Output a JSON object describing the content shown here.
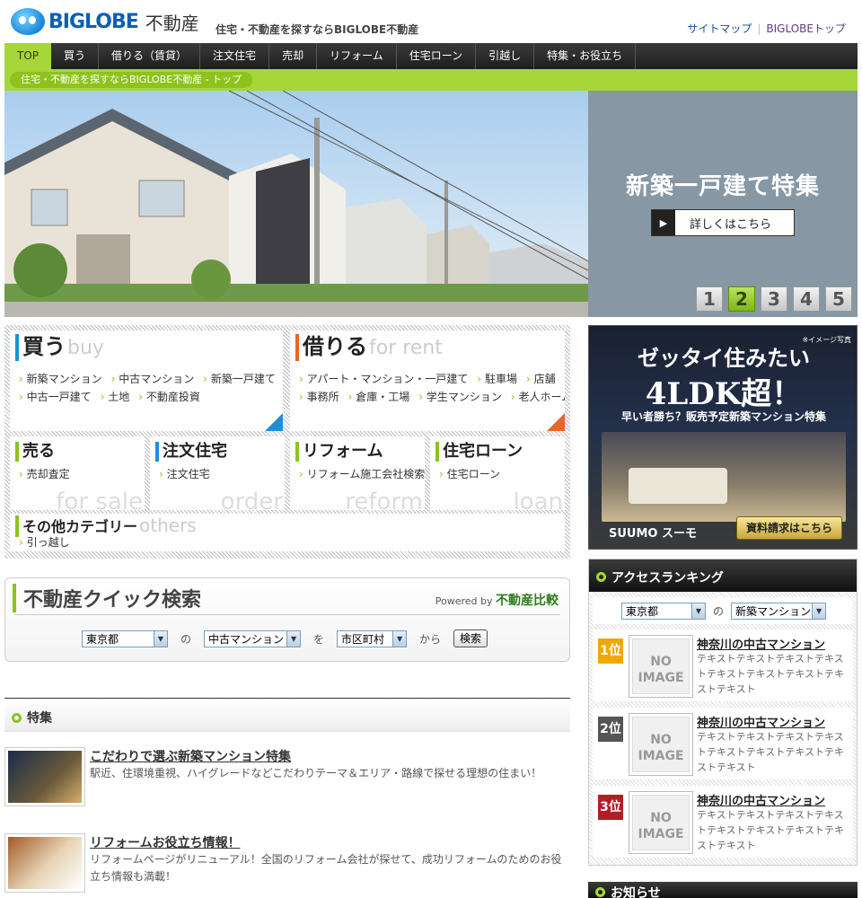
{
  "brand": {
    "logo_text": "BIGLOBE",
    "logo_suffix": "不動産",
    "tagline": "住宅・不動産を探すならBIGLOBE不動産"
  },
  "top_links": {
    "sitemap": "サイトマップ",
    "biglobe_top": "BIGLOBEトップ"
  },
  "nav": [
    "TOP",
    "買う",
    "借りる（賃貸）",
    "注文住宅",
    "売却",
    "リフォーム",
    "住宅ローン",
    "引越し",
    "特集・お役立ち"
  ],
  "breadcrumb": "住宅・不動産を探すならBIGLOBE不動産 - トップ",
  "hero": {
    "title": "新築一戸建て特集",
    "button": "詳しくはこちら",
    "pages": [
      "1",
      "2",
      "3",
      "4",
      "5"
    ],
    "active_page": "2"
  },
  "categories": {
    "buy": {
      "title": "買う",
      "en": "buy",
      "links": [
        "新築マンション",
        "中古マンション",
        "新築一戸建て",
        "中古一戸建て",
        "土地",
        "不動産投資"
      ]
    },
    "rent": {
      "title": "借りる",
      "en": "for rent",
      "links": [
        "アパート・マンション・一戸建て",
        "駐車場",
        "店舗",
        "事務所",
        "倉庫・工場",
        "学生マンション",
        "老人ホーム"
      ]
    },
    "sell": {
      "title": "売る",
      "en": "for sale",
      "links": [
        "売却査定"
      ]
    },
    "order": {
      "title": "注文住宅",
      "en": "order",
      "links": [
        "注文住宅"
      ]
    },
    "reform": {
      "title": "リフォーム",
      "en": "reform",
      "links": [
        "リフォーム施工会社検索"
      ]
    },
    "loan": {
      "title": "住宅ローン",
      "en": "loan",
      "links": [
        "住宅ローン"
      ]
    },
    "others": {
      "title": "その他カテゴリー",
      "en": "others",
      "links": [
        "引っ越し"
      ]
    }
  },
  "quick_search": {
    "title": "不動産クイック検索",
    "powered_by": "Powered by",
    "powered_brand": "不動産比較",
    "pref": "東京都",
    "of": "の",
    "type": "中古マンション",
    "wo": "を",
    "area": "市区町村",
    "kara": "から",
    "button": "検索"
  },
  "tokushu": {
    "heading": "特集",
    "items": [
      {
        "title": "こだわりで選ぶ新築マンション特集",
        "desc": "駅近、住環境重視、ハイグレードなどこだわりテーマ＆エリア・路線で探せる理想の住まい！"
      },
      {
        "title": "リフォームお役立ち情報！",
        "desc": "リフォームページがリニューアル！全国のリフォーム会社が探せて、成功リフォームのためのお役立ち情報も満載！"
      }
    ]
  },
  "ad": {
    "note": "※イメージ写真",
    "line1": "ゼッタイ住みたい",
    "line2": "4LDK超！",
    "line3": "早い者勝ち？販売予定新築マンション特集",
    "brand": "SUUMO スーモ",
    "button": "資料請求はこちら"
  },
  "ranking": {
    "heading": "アクセスランキング",
    "pref": "東京都",
    "of": "の",
    "type": "新築マンション",
    "no_image": "NO IMAGE",
    "items": [
      {
        "rank": "1位",
        "name": "神奈川の中古マンション",
        "text": "テキストテキストテキストテキストテキストテキストテキストテキストテキスト"
      },
      {
        "rank": "2位",
        "name": "神奈川の中古マンション",
        "text": "テキストテキストテキストテキストテキストテキストテキストテキストテキスト"
      },
      {
        "rank": "3位",
        "name": "神奈川の中古マンション",
        "text": "テキストテキストテキストテキストテキストテキストテキストテキストテキスト"
      }
    ],
    "colors": [
      "#f0a800",
      "#555555",
      "#b31d24"
    ]
  },
  "oshirase": "お知らせ",
  "colors": {
    "accent": "#a6d637",
    "nav_bg": "#222222",
    "link": "#1a4f9c"
  }
}
